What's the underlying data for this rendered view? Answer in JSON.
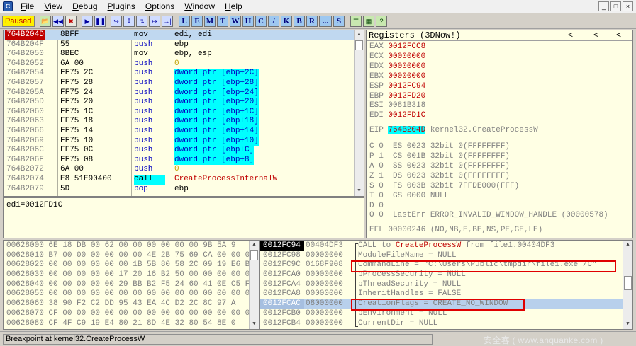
{
  "menu": {
    "items": [
      "File",
      "View",
      "Debug",
      "Plugins",
      "Options",
      "Window",
      "Help"
    ],
    "window_controls": [
      "_",
      "□",
      "×"
    ]
  },
  "toolbar": {
    "status": "Paused",
    "buttons": [
      "📂",
      "◀◀",
      "✖",
      "▶",
      "❚❚",
      "↪",
      "↧",
      "↴",
      "↦",
      "→|"
    ],
    "letter_buttons": [
      "L",
      "E",
      "M",
      "T",
      "W",
      "H",
      "C",
      "/",
      "K",
      "B",
      "R",
      "...",
      "S"
    ],
    "extra_buttons": [
      "☰",
      "▦",
      "?"
    ]
  },
  "disassembly": [
    {
      "addr": "764B204D",
      "hex": "8BFF",
      "mnem": "mov",
      "ops": "edi, edi",
      "selected": true
    },
    {
      "addr": "764B204F",
      "hex": "55",
      "mnem": "push",
      "ops": "ebp"
    },
    {
      "addr": "764B2050",
      "hex": "8BEC",
      "mnem": "mov",
      "ops": "ebp, esp"
    },
    {
      "addr": "764B2052",
      "hex": "6A 00",
      "mnem": "push",
      "ops": "0",
      "ops_type": "num"
    },
    {
      "addr": "764B2054",
      "hex": "FF75 2C",
      "mnem": "push",
      "ops": "dword ptr [ebp+2C]",
      "ops_type": "mem"
    },
    {
      "addr": "764B2057",
      "hex": "FF75 28",
      "mnem": "push",
      "ops": "dword ptr [ebp+28]",
      "ops_type": "mem"
    },
    {
      "addr": "764B205A",
      "hex": "FF75 24",
      "mnem": "push",
      "ops": "dword ptr [ebp+24]",
      "ops_type": "mem"
    },
    {
      "addr": "764B205D",
      "hex": "FF75 20",
      "mnem": "push",
      "ops": "dword ptr [ebp+20]",
      "ops_type": "mem"
    },
    {
      "addr": "764B2060",
      "hex": "FF75 1C",
      "mnem": "push",
      "ops": "dword ptr [ebp+1C]",
      "ops_type": "mem"
    },
    {
      "addr": "764B2063",
      "hex": "FF75 18",
      "mnem": "push",
      "ops": "dword ptr [ebp+18]",
      "ops_type": "mem"
    },
    {
      "addr": "764B2066",
      "hex": "FF75 14",
      "mnem": "push",
      "ops": "dword ptr [ebp+14]",
      "ops_type": "mem"
    },
    {
      "addr": "764B2069",
      "hex": "FF75 10",
      "mnem": "push",
      "ops": "dword ptr [ebp+10]",
      "ops_type": "mem"
    },
    {
      "addr": "764B206C",
      "hex": "FF75 0C",
      "mnem": "push",
      "ops": "dword ptr [ebp+C]",
      "ops_type": "mem"
    },
    {
      "addr": "764B206F",
      "hex": "FF75 08",
      "mnem": "push",
      "ops": "dword ptr [ebp+8]",
      "ops_type": "mem"
    },
    {
      "addr": "764B2072",
      "hex": "6A 00",
      "mnem": "push",
      "ops": "0",
      "ops_type": "num"
    },
    {
      "addr": "764B2074",
      "hex": "E8 51E90400",
      "mnem": "call",
      "ops": "CreateProcessInternalW",
      "ops_type": "call"
    },
    {
      "addr": "764B2079",
      "hex": "5D",
      "mnem": "pop",
      "ops": "ebp"
    }
  ],
  "info": {
    "text": "edi=0012FD1C"
  },
  "registers": {
    "header": "Registers (3DNow!)",
    "nav": [
      "<",
      "<",
      "<"
    ],
    "gprs": [
      {
        "name": "EAX",
        "value": "0012FCC8",
        "changed": true
      },
      {
        "name": "ECX",
        "value": "00000000",
        "changed": true
      },
      {
        "name": "EDX",
        "value": "00000000",
        "changed": true
      },
      {
        "name": "EBX",
        "value": "00000000",
        "changed": true
      },
      {
        "name": "ESP",
        "value": "0012FC94",
        "changed": true
      },
      {
        "name": "EBP",
        "value": "0012FD20",
        "changed": true
      },
      {
        "name": "ESI",
        "value": "0081B318",
        "changed": false
      },
      {
        "name": "EDI",
        "value": "0012FD1C",
        "changed": true
      }
    ],
    "eip": {
      "name": "EIP",
      "value": "764B204D",
      "comment": "kernel32.CreateProcessW"
    },
    "flags": [
      "C 0  ES 0023 32bit 0(FFFFFFFF)",
      "P 1  CS 001B 32bit 0(FFFFFFFF)",
      "A 0  SS 0023 32bit 0(FFFFFFFF)",
      "Z 1  DS 0023 32bit 0(FFFFFFFF)",
      "S 0  FS 003B 32bit 7FFDE000(FFF)",
      "T 0  GS 0000 NULL",
      "D 0",
      "O 0  LastErr ERROR_INVALID_WINDOW_HANDLE (00000578)"
    ],
    "efl": "EFL 00000246 (NO,NB,E,BE,NS,PE,GE,LE)"
  },
  "dump": [
    "00628000 6E 18 DB 00 62 00 00 00 00 00 00 9B 5A 9",
    "00628010 B7 00 00 00 00 00 00 4E 2B 75 69 CA 00 00 0",
    "00628020 00 00 00 00 00 00 1B 5B 80 58 2C 09 19 E6 B",
    "00628030 00 00 00 00 00 17 20 16 B2 50 00 00 00 00 0",
    "00628040 00 00 00 00 00 29 BB B2 F5 24 60 41 0E C5 F",
    "00628050 00 00 00 00 00 00 00 00 00 00 00 00 00 00 0",
    "00628060 38 90 F2 C2 DD 95 43 EA 4C D2 2C 8C 97 A",
    "00628070 CF 00 00 00 00 00 00 00 00 00 00 00 00 00 0",
    "00628080 CF 4F C9 19 E4 80 21 8D 4E 32 80 54 8E 0"
  ],
  "stack": [
    {
      "addr": "0012FC94",
      "value": "00404DF3",
      "comment_pre": "CALL to ",
      "fn": "CreateProcessW",
      "comment_post": " from file1.00404DF3",
      "top": true
    },
    {
      "addr": "0012FC98",
      "value": "00000000",
      "comment": "ModuleFileName = NULL"
    },
    {
      "addr": "0012FC9C",
      "value": "0168F908",
      "comment": "CommandLine = \"C:\\Users\\Public\\tmpdir\\file1.exe /C\""
    },
    {
      "addr": "0012FCA0",
      "value": "00000000",
      "comment": "pProcessSecurity = NULL"
    },
    {
      "addr": "0012FCA4",
      "value": "00000000",
      "comment": "pThreadSecurity = NULL"
    },
    {
      "addr": "0012FCA8",
      "value": "00000000",
      "comment": "InheritHandles = FALSE"
    },
    {
      "addr": "0012FCAC",
      "value": "08000000",
      "comment": "CreationFlags = CREATE_NO_WINDOW",
      "highlight": true
    },
    {
      "addr": "0012FCB0",
      "value": "00000000",
      "comment": "pEnvironment = NULL"
    },
    {
      "addr": "0012FCB4",
      "value": "00000000",
      "comment": "CurrentDir = NULL"
    }
  ],
  "statusbar": {
    "text": "Breakpoint at kernel32.CreateProcessW"
  },
  "watermark": "安全客 ( www.anquanke.com )"
}
